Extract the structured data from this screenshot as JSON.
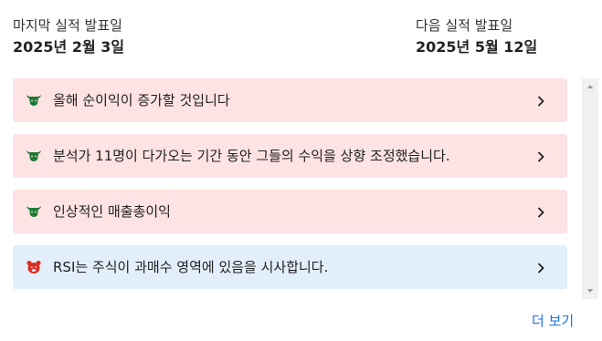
{
  "earnings": {
    "last_label": "마지막 실적 발표일",
    "last_date": "2025년 2월 3일",
    "next_label": "다음 실적 발표일",
    "next_date": "2025년 5월 12일"
  },
  "insights": [
    {
      "sentiment": "bullish",
      "icon": "bull-icon",
      "text": "올해 순이익이 증가할 것입니다"
    },
    {
      "sentiment": "bullish",
      "icon": "bull-icon",
      "text": "분석가 11명이 다가오는 기간 동안 그들의 수익을 상향 조정했습니다."
    },
    {
      "sentiment": "bullish",
      "icon": "bull-icon",
      "text": "인상적인 매출총이익"
    },
    {
      "sentiment": "bearish",
      "icon": "bear-icon",
      "text": "RSI는 주식이 과매수 영역에 있음을 시사합니다."
    }
  ],
  "more_label": "더 보기",
  "colors": {
    "bull_bg": "#fde3e3",
    "bear_bg": "#e3eefb",
    "bull_icon": "#1e7a34",
    "bear_icon": "#d93025",
    "link": "#1a73e8"
  }
}
